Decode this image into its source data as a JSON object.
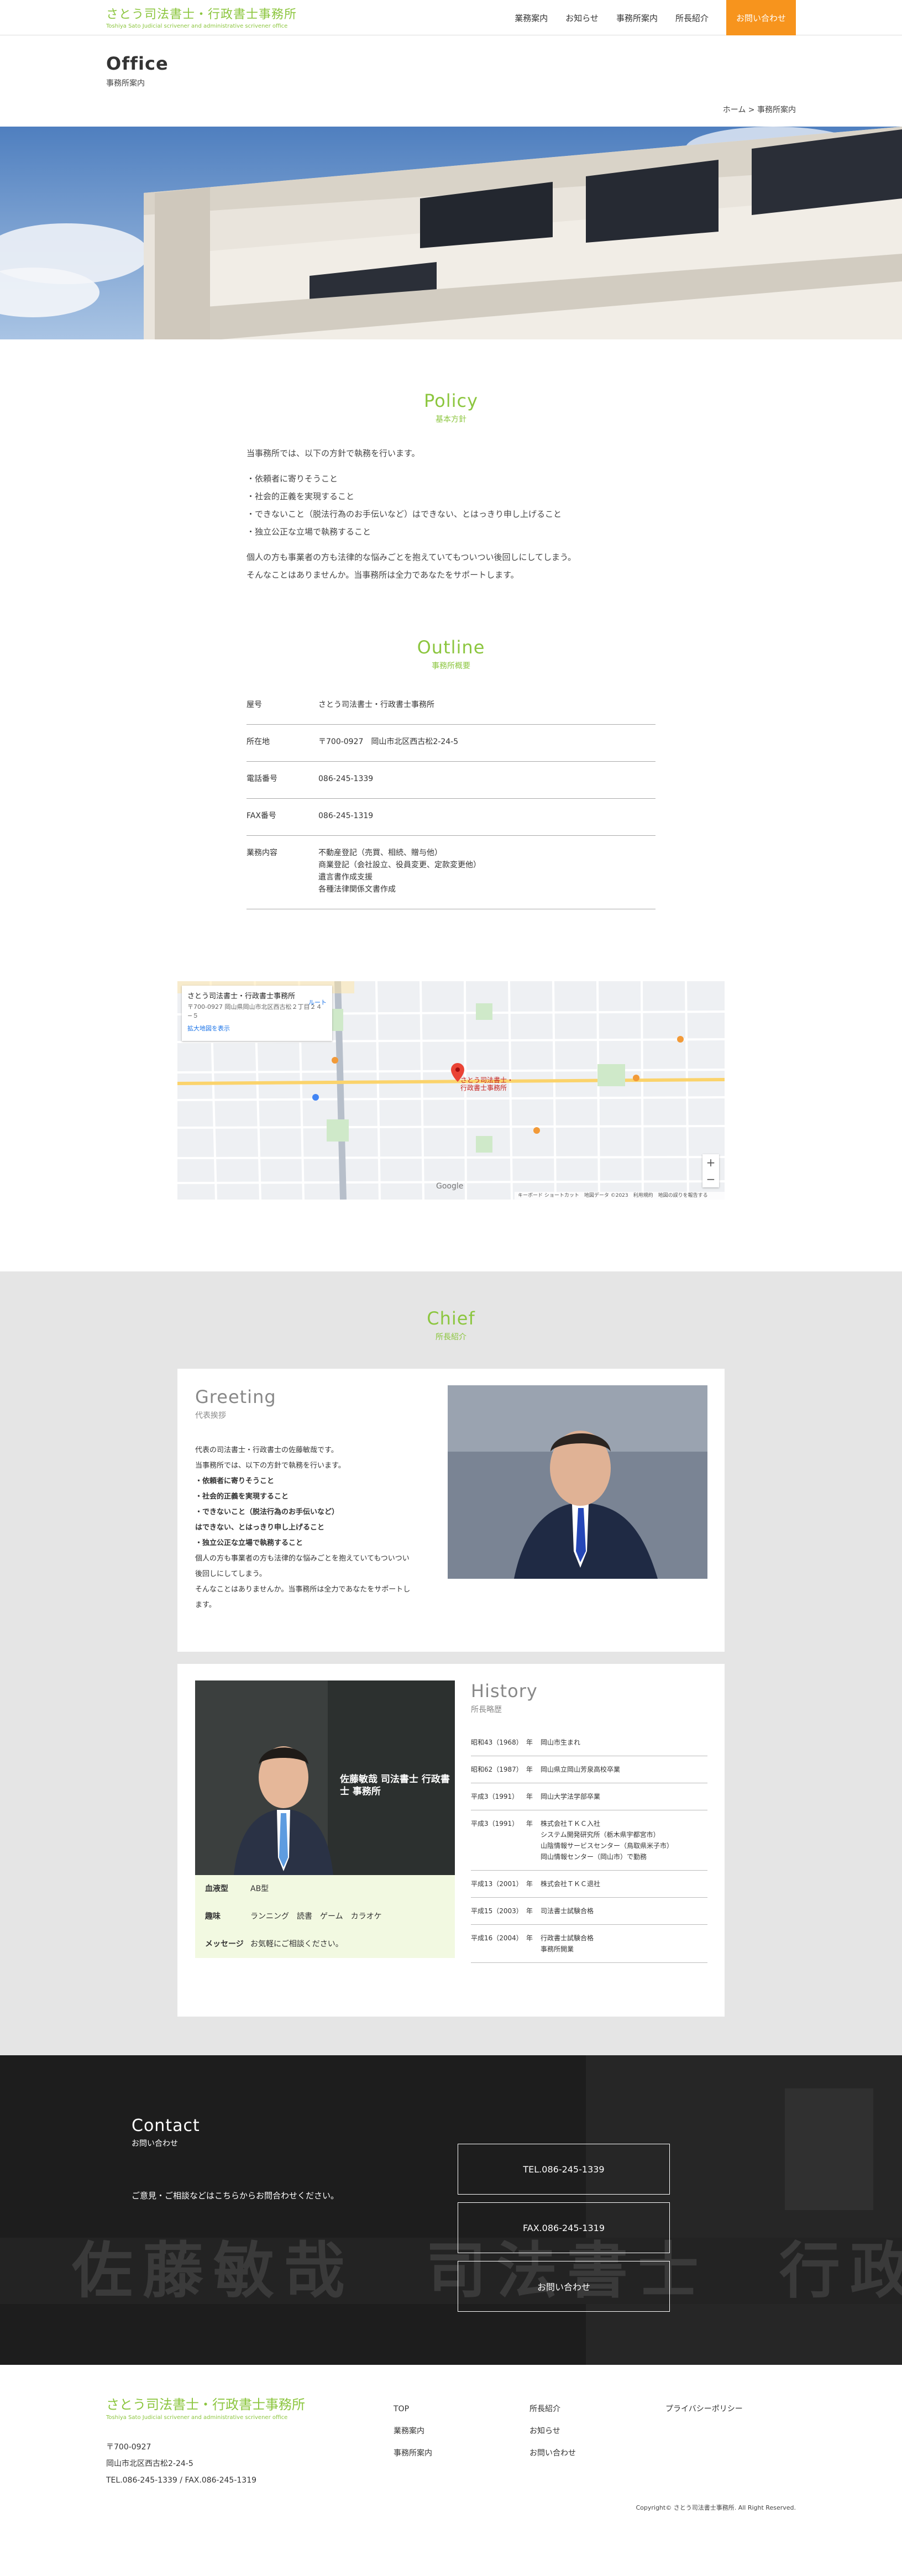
{
  "header": {
    "logo_title": "さとう司法書士・行政書士事務所",
    "logo_sub": "Toshiya Sato Judicial scrivener and administrative scrivener office",
    "nav": [
      {
        "label": "業務案内"
      },
      {
        "label": "お知らせ"
      },
      {
        "label": "事務所案内"
      },
      {
        "label": "所長紹介"
      }
    ],
    "contact_label": "お問い合わせ",
    "accent_color": "#8cc63f",
    "button_color": "#f7941d"
  },
  "page": {
    "title": "Office",
    "subtitle": "事務所案内",
    "breadcrumb": "ホーム > 事務所案内"
  },
  "policy": {
    "heading_en": "Policy",
    "heading_ja": "基本方針",
    "intro": "当事務所では、以下の方針で執務を行います。",
    "items": [
      "・依頼者に寄りそうこと",
      "・社会的正義を実現すること",
      "・できないこと（脱法行為のお手伝いなど）はできない、とはっきり申し上げること",
      "・独立公正な立場で執務すること"
    ],
    "closing_1": "個人の方も事業者の方も法律的な悩みごとを抱えていてもついつい後回しにしてしまう。",
    "closing_2": "そんなことはありませんか。当事務所は全力であなたをサポートします。"
  },
  "outline": {
    "heading_en": "Outline",
    "heading_ja": "事務所概要",
    "rows": [
      {
        "label": "屋号",
        "value": "さとう司法書士・行政書士事務所"
      },
      {
        "label": "所在地",
        "value": "〒700-0927　岡山市北区西古松2-24-5"
      },
      {
        "label": "電話番号",
        "value": "086-245-1339"
      },
      {
        "label": "FAX番号",
        "value": "086-245-1319"
      },
      {
        "label": "業務内容",
        "value": "不動産登記（売買、相続、贈与他）",
        "v2": "商業登記（会社設立、役員変更、定款変更他）",
        "v3": "遺言書作成支援",
        "v4": "各種法律関係文書作成"
      }
    ]
  },
  "map": {
    "info_title": "さとう司法書士・行政書士事務所",
    "info_address": "〒700-0927 岡山県岡山市北区西古松２丁目２４−５",
    "info_route": "ルート",
    "info_link": "拡大地図を表示",
    "pin_label_1": "さとう司法書士・",
    "pin_label_2": "行政書士事務所",
    "google": "Google",
    "footer_text": "キーボード ショートカット　地図データ ©2023　利用規約　地図の誤りを報告する"
  },
  "chief": {
    "heading_en": "Chief",
    "heading_ja": "所長紹介",
    "greeting_title": "Greeting",
    "greeting_sub": "代表挨拶",
    "greeting_lines": [
      "代表の司法書士・行政書士の佐藤敏哉です。",
      "当事務所では、以下の方針で執務を行います。",
      "・依頼者に寄りそうこと",
      "・社会的正義を実現すること",
      "・できないこと（脱法行為のお手伝いなど）",
      "はできない、とはっきり申し上げること",
      "・独立公正な立場で執務すること",
      "個人の方も事業者の方も法律的な悩みごとを抱えていてもついつい",
      "後回しにしてしまう。",
      "そんなことはありませんか。当事務所は全力であなたをサポートし",
      "ます。"
    ],
    "history_title": "History",
    "history_sub": "所長略歴",
    "sign_text": "佐藤敏哉 司法書士 行政書士 事務所",
    "profile": [
      {
        "label": "血液型",
        "value": "AB型"
      },
      {
        "label": "趣味",
        "value": "ランニング　読書　ゲーム　カラオケ"
      },
      {
        "label": "メッセージ",
        "value": "お気軽にご相談ください。"
      }
    ],
    "history": [
      {
        "year": "昭和43（1968）",
        "n": "年",
        "text": "岡山市生まれ"
      },
      {
        "year": "昭和62（1987）",
        "n": "年",
        "text": "岡山県立岡山芳泉高校卒業"
      },
      {
        "year": "平成3（1991）",
        "n": "年",
        "text": "岡山大学法学部卒業"
      },
      {
        "year": "平成3（1991）",
        "n": "年",
        "text": "株式会社ＴＫＣ入社",
        "t2": "システム開発研究所（栃木県宇都宮市）",
        "t3": "山陰情報サービスセンター（鳥取県米子市）",
        "t4": "岡山情報センター（岡山市）で勤務"
      },
      {
        "year": "平成13（2001）",
        "n": "年",
        "text": "株式会社ＴＫＣ退社"
      },
      {
        "year": "平成15（2003）",
        "n": "年",
        "text": "司法書士試験合格"
      },
      {
        "year": "平成16（2004）",
        "n": "年",
        "text": "行政書士試験合格",
        "t2": "事務所開業"
      }
    ]
  },
  "contact": {
    "heading_en": "Contact",
    "heading_ja": "お問い合わせ",
    "message": "ご意見・ご相談などはこちらからお問合わせください。",
    "tel": "TEL.086-245-1339",
    "fax": "FAX.086-245-1319",
    "form": "お問い合わせ",
    "bg_text": "佐藤敏哉　司法書士　行政書士　事務所"
  },
  "footer": {
    "logo_title": "さとう司法書士・行政書士事務所",
    "logo_sub": "Toshiya Sato Judicial scrivener and administrative scrivener office",
    "zip": "〒700-0927",
    "address": "岡山市北区西古松2-24-5",
    "phones": "TEL.086-245-1339 / FAX.086-245-1319",
    "col1": [
      "TOP",
      "業務案内",
      "事務所案内"
    ],
    "col2": [
      "所長紹介",
      "お知らせ",
      "お問い合わせ"
    ],
    "col3": [
      "プライバシーポリシー"
    ],
    "copyright": "Copyright© さとう司法書士事務所. All Right Reserved."
  }
}
